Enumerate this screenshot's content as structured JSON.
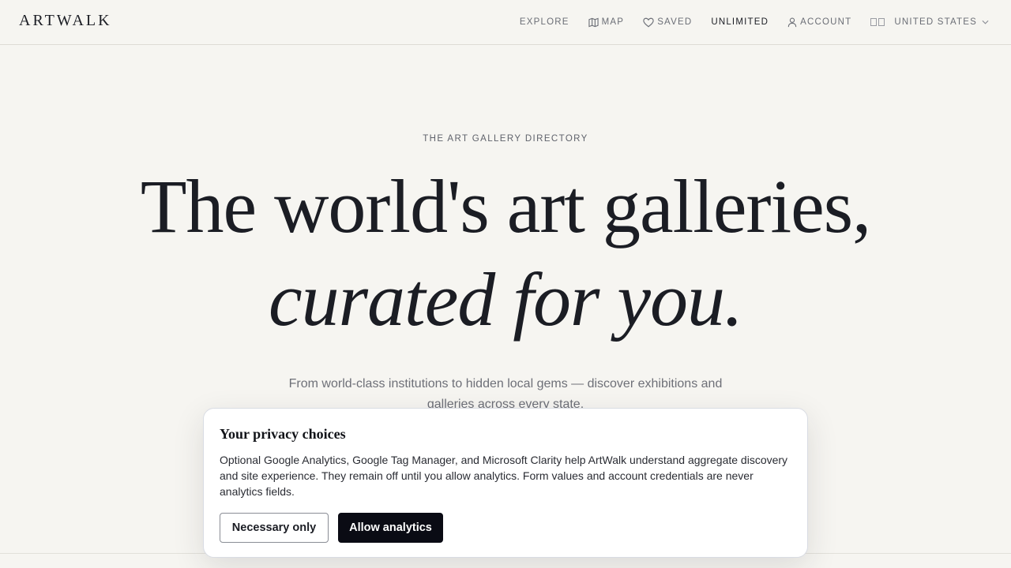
{
  "header": {
    "logo": "ARTWALK",
    "nav": {
      "explore": "EXPLORE",
      "map": "MAP",
      "saved": "SAVED",
      "unlimited": "UNLIMITED",
      "account": "ACCOUNT",
      "country": "UNITED STATES"
    }
  },
  "hero": {
    "eyebrow": "THE ART GALLERY DIRECTORY",
    "headline_line1": "The world's art galleries,",
    "headline_line2": "curated for you.",
    "subtitle": "From world-class institutions to hidden local gems — discover exhibitions and galleries across every state."
  },
  "consent": {
    "title": "Your privacy choices",
    "body": "Optional Google Analytics, Google Tag Manager, and Microsoft Clarity help ArtWalk understand aggregate discovery and site experience. They remain off until you allow analytics. Form values and account credentials are never analytics fields.",
    "necessary_label": "Necessary only",
    "allow_label": "Allow analytics"
  },
  "colors": {
    "background": "#f6f5f1",
    "text": "#1b1d24",
    "primary_button": "#0a0b14"
  }
}
